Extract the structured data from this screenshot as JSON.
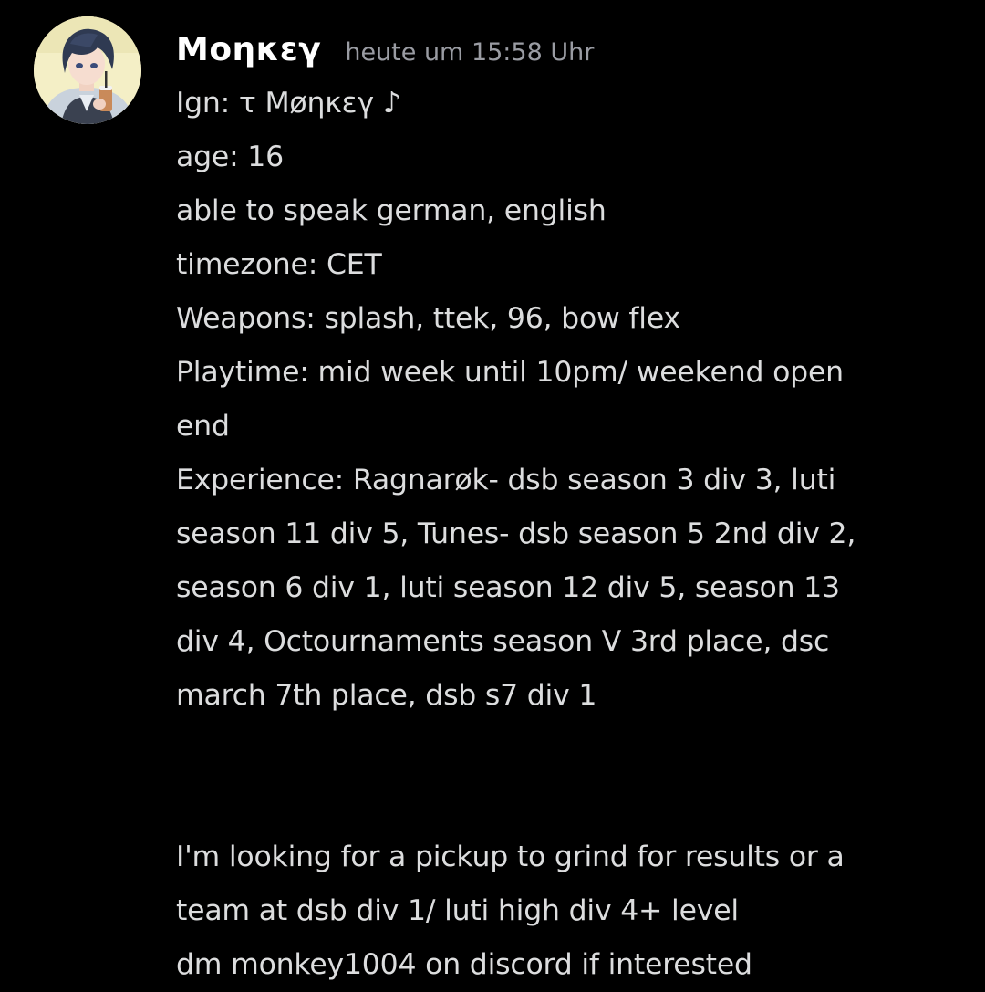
{
  "message": {
    "username": "Μοηκεγ",
    "timestamp": "heute um 15:58 Uhr",
    "lines": [
      "Ign: τ Μøηκεγ ♪",
      "age: 16",
      "able to speak german, english",
      "timezone: CET",
      "Weapons: splash, ttek, 96, bow flex",
      "Playtime: mid week until 10pm/ weekend open",
      "end",
      "Experience:  Ragnarøk- dsb season 3 div 3, luti",
      "season 11 div 5, Tunes- dsb season 5 2nd div 2,",
      "season 6 div 1, luti season 12 div 5, season 13",
      "div 4, Octournaments season V 3rd place, dsc",
      "march 7th place, dsb s7 div 1",
      "",
      "",
      "I'm looking for a pickup to grind for results or a",
      "team at dsb div 1/ luti high div 4+ level",
      "dm monkey1004 on discord if interested"
    ],
    "avatar_icon": "anime-character-avatar"
  },
  "colors": {
    "background": "#000000",
    "username": "#ffffff",
    "timestamp": "#9a9ca3",
    "text": "#dcddde"
  }
}
